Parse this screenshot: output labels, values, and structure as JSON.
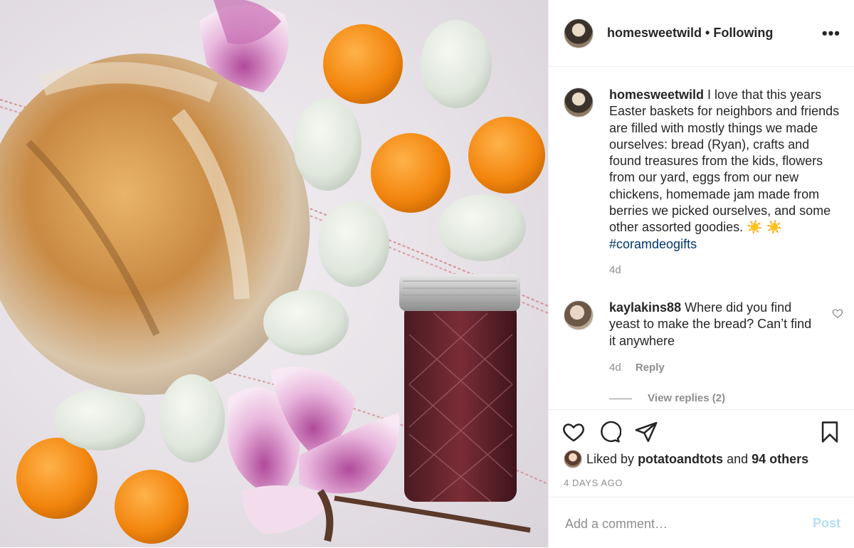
{
  "header": {
    "username": "homesweetwild",
    "separator": "•",
    "follow_status": "Following",
    "more_label": "•••"
  },
  "post": {
    "photo_alt": "Flat lay of bread, eggs, clementines, magnolia flowers and a jar of jam"
  },
  "caption": {
    "username": "homesweetwild",
    "text": "I love that this years Easter baskets for neighbors and friends are filled with mostly things we made ourselves: bread (Ryan), crafts and found treasures from the kids, flowers from our yard, eggs from our new chickens, homemade jam made from berries we picked ourselves, and some other assorted goodies. ☀️ ☀️",
    "hashtag": "#coramdeogifts",
    "age": "4d"
  },
  "comment": {
    "username": "kaylakins88",
    "text": "Where did you find yeast to make the bread? Can’t find it anywhere",
    "age": "4d",
    "reply_label": "Reply",
    "view_replies": "View replies (2)"
  },
  "actions": {
    "icons": [
      "heart-icon",
      "comment-icon",
      "share-icon",
      "bookmark-icon"
    ],
    "liked_by_prefix": "Liked by",
    "liked_by_user": "potatoandtots",
    "liked_by_and": "and",
    "liked_by_others": "94 others",
    "timestamp": "4 DAYS AGO"
  },
  "comment_box": {
    "placeholder": "Add a comment…",
    "post_label": "Post"
  },
  "colors": {
    "text": "#262626",
    "secondary": "#8e8e8e",
    "hashtag": "#00376b",
    "post_disabled": "#b2dffc",
    "divider": "#efefef"
  }
}
